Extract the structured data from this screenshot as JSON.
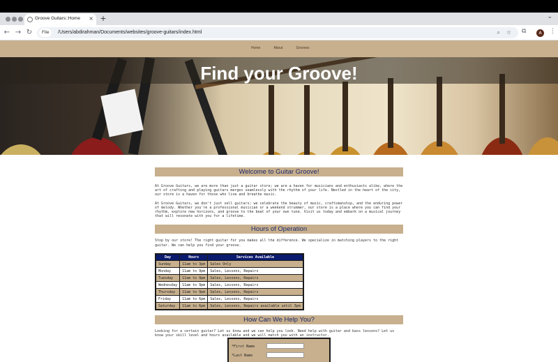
{
  "browser": {
    "tab_title": "Groove Guitars::Home",
    "tab_close": "×",
    "new_tab": "+",
    "tabstrip_menu": "⌄",
    "back": "←",
    "forward": "→",
    "reload": "↻",
    "file_chip": "File",
    "url": "/Users/abdirahman/Documents/websites/groove-guitars/index.html",
    "profile_initial": "A",
    "more": "⋮"
  },
  "nav": {
    "items": [
      "Home",
      "About",
      "Grooves"
    ]
  },
  "hero": {
    "title": "Find your Groove!"
  },
  "welcome": {
    "heading": "Welcome to Guitar Groove!",
    "p1": "At Groove Guitars, we are more than just a guitar store; we are a haven for musicians and enthusiasts alike, where the art of crafting and playing guitars merges seamlessly with the rhythm of your life. Nestled in the heart of the city, our store is a haven for those who live and breathe music.",
    "p2": "At Groove Guitars, we don't just sell guitars; we celebrate the beauty of music, craftsmanship, and the enduring power of melody. Whether you're a professional musician or a weekend strummer, our store is a place where you can find your rhythm, explore new horizons, and groove to the beat of your own tune. Visit us today and embark on a musical journey that will resonate with you for a lifetime."
  },
  "hours": {
    "heading": "Hours of Operation",
    "intro": "Stop by our store! The right guitar for you makes all the difference. We specialize in matching players to the right guitar. We can help you find your groove.",
    "columns": [
      "Day",
      "Hours",
      "Services Available"
    ],
    "rows": [
      [
        "Sunday",
        "11am to 3pm",
        "Sales Only"
      ],
      [
        "Monday",
        "11am to 9pm",
        "Sales, Lessons, Repairs"
      ],
      [
        "Tuesday",
        "11am to 9pm",
        "Sales, Lessons, Repairs"
      ],
      [
        "Wednesday",
        "11am to 9pm",
        "Sales, Lessons, Repairs"
      ],
      [
        "Thursday",
        "11am to 9pm",
        "Sales, Lessons, Repairs"
      ],
      [
        "Friday",
        "11am to 6pm",
        "Sales, Lessons, Repairs"
      ],
      [
        "Saturday",
        "11am to 6pm",
        "Sales, Lessons, Repairs available until 3pm"
      ]
    ]
  },
  "help": {
    "heading": "How Can We Help You?",
    "intro": "Looking for a certain guitar? Let us know and we can help you look. Need help with guitar and bass lessons? Let us know your skill level and hours available and we will match you with an instructor.",
    "fields": [
      {
        "label": "*First Name",
        "value": ""
      },
      {
        "label": "*Last Name",
        "value": ""
      }
    ]
  },
  "colors": {
    "accent_tan": "#c8b08e",
    "heading_blue": "#1c2a6b",
    "table_header": "#0a1a6e"
  }
}
